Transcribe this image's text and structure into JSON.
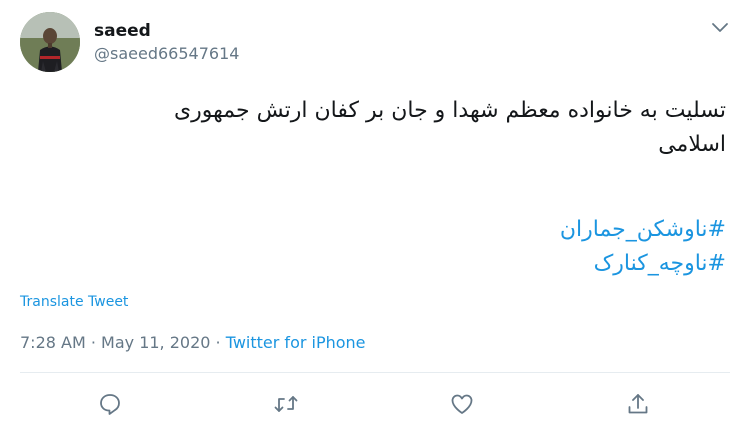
{
  "author": {
    "display_name": "saeed",
    "handle": "@saeed66547614"
  },
  "tweet": {
    "text_line1": "تسلیت به خانواده معظم شهدا و جان بر کفان ارتش جمهوری",
    "text_line2": "اسلامی",
    "hashtags": [
      "#ناوشکن_جماران",
      "#ناوچه_کنارک"
    ]
  },
  "translate_label": "Translate Tweet",
  "meta": {
    "time": "7:28 AM",
    "separator": " · ",
    "date": "May 11, 2020",
    "source": "Twitter for iPhone"
  },
  "actions": {
    "reply_icon": "reply-icon",
    "retweet_icon": "retweet-icon",
    "like_icon": "like-icon",
    "share_icon": "share-icon"
  },
  "colors": {
    "link": "#1b95e0",
    "secondary_text": "#657786",
    "primary_text": "#14171a"
  }
}
